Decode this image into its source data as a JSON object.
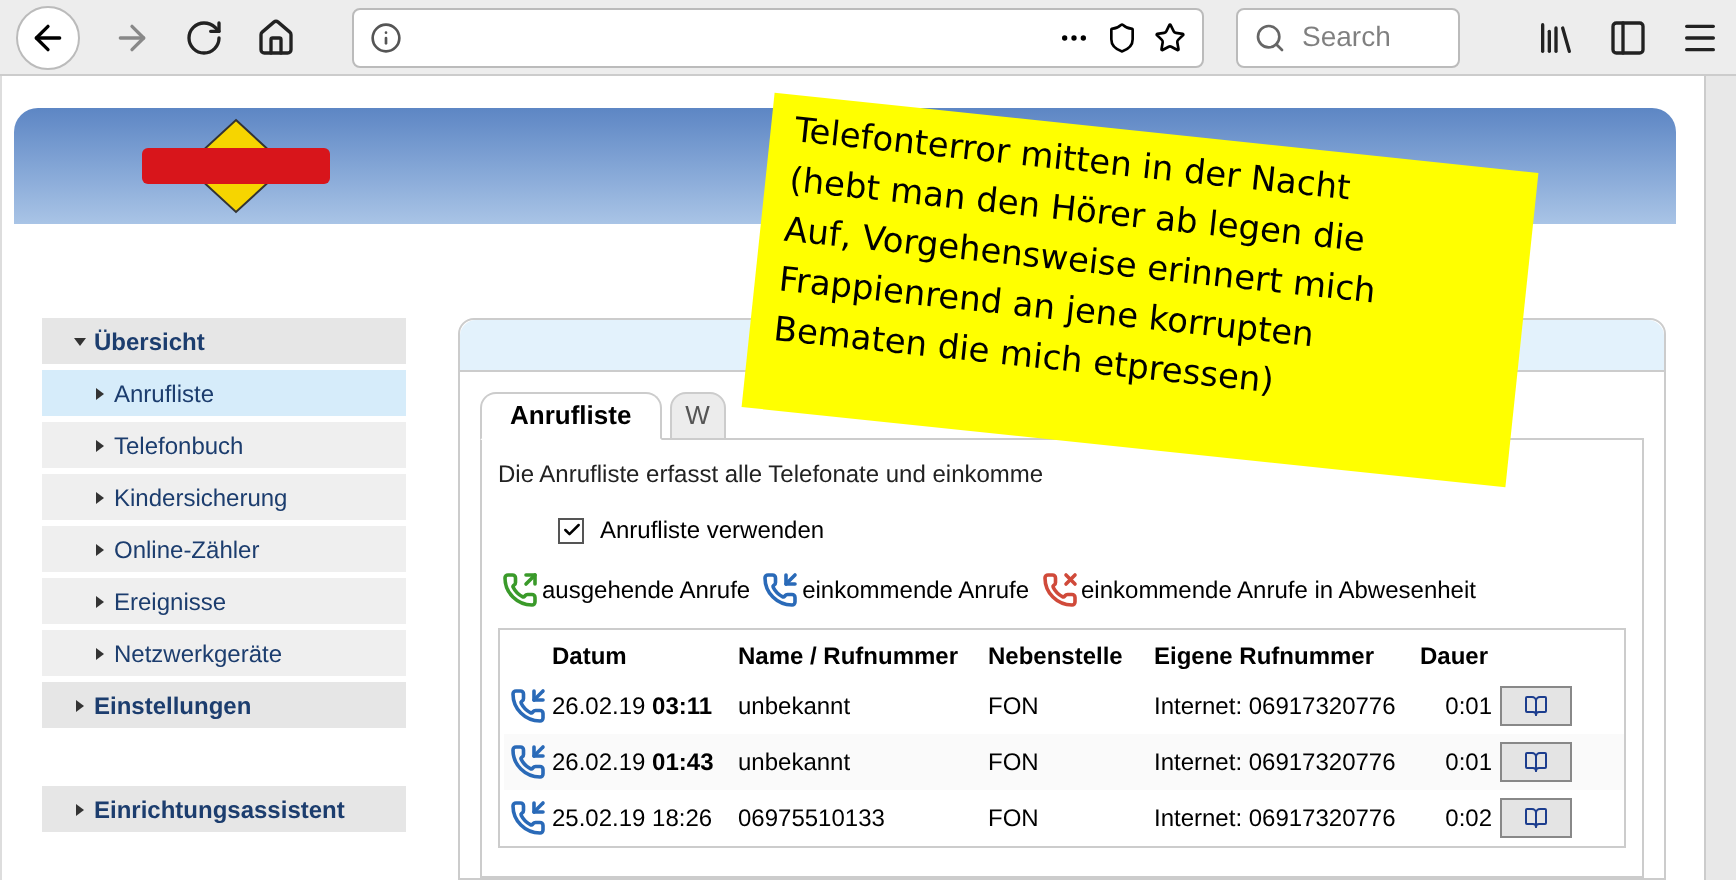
{
  "browser": {
    "search_placeholder": "Search"
  },
  "sidebar": {
    "sections": [
      [
        {
          "label": "Übersicht",
          "expanded": true,
          "children": [
            {
              "label": "Anrufliste",
              "selected": true
            },
            {
              "label": "Telefonbuch",
              "selected": false
            },
            {
              "label": "Kindersicherung",
              "selected": false
            },
            {
              "label": "Online-Zähler",
              "selected": false
            },
            {
              "label": "Ereignisse",
              "selected": false
            },
            {
              "label": "Netzwerkgeräte",
              "selected": false
            }
          ]
        },
        {
          "label": "Einstellungen",
          "expanded": false
        }
      ],
      [
        {
          "label": "Einrichtungsassistent",
          "expanded": false
        }
      ]
    ]
  },
  "tabs": [
    {
      "label": "Anrufliste",
      "selected": true
    },
    {
      "label": "W",
      "selected": false
    }
  ],
  "description": "Die Anrufliste erfasst alle Telefonate und einkomme",
  "use_list": {
    "label": "Anrufliste verwenden",
    "checked": true
  },
  "legend": [
    {
      "kind": "outgoing",
      "label": "ausgehende Anrufe"
    },
    {
      "kind": "incoming",
      "label": "einkommende Anrufe"
    },
    {
      "kind": "missed",
      "label": "einkommende Anrufe in Abwesenheit"
    }
  ],
  "table": {
    "columns": [
      "Datum",
      "Name / Rufnummer",
      "Nebenstelle",
      "Eigene Rufnummer",
      "Dauer"
    ],
    "rows": [
      {
        "kind": "incoming",
        "cells": [
          "26.02.19 **03:11**",
          "unbekannt",
          "FON",
          "Internet: 06917320776",
          "0:01"
        ]
      },
      {
        "kind": "incoming",
        "cells": [
          "26.02.19 **01:43**",
          "unbekannt",
          "FON",
          "Internet: 06917320776",
          "0:01"
        ]
      },
      {
        "kind": "incoming",
        "cells": [
          "25.02.19 18:26",
          "06975510133",
          "FON",
          "Internet: 06917320776",
          "0:02"
        ]
      }
    ]
  },
  "note": {
    "lines": [
      "Telefonterror mitten in der Nacht",
      "(hebt man den Hörer ab legen die",
      "Auf, Vorgehensweise erinnert mich",
      "Frappienrend an jene korrupten",
      "Bematen die mich etpressen)"
    ]
  }
}
